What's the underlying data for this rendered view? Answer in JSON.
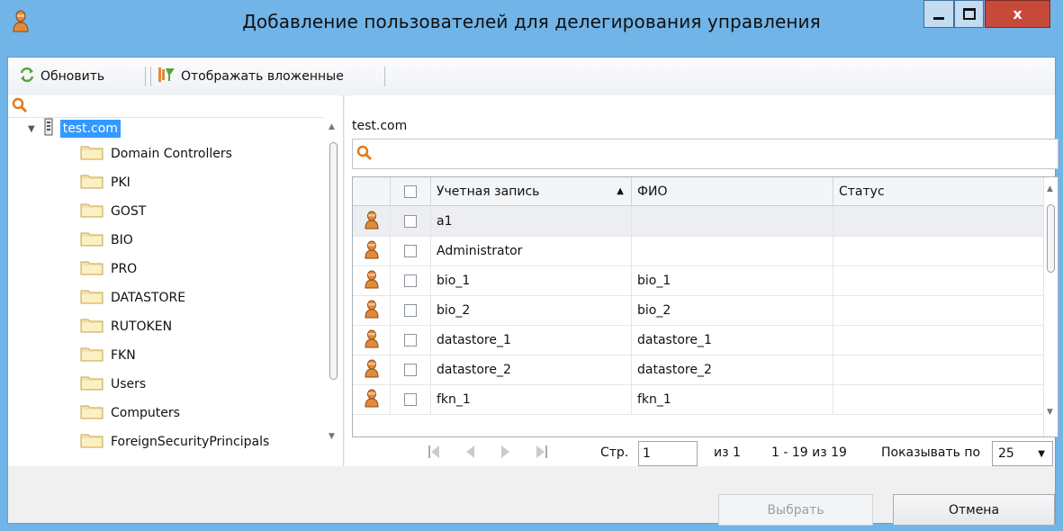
{
  "window": {
    "title": "Добавление пользователей для делегирования управления",
    "close_glyph": "x"
  },
  "toolbar": {
    "refresh_label": "Обновить",
    "show_nested_label": "Отображать вложенные"
  },
  "tree": {
    "root_label": "test.com",
    "items": [
      {
        "label": "Domain Controllers"
      },
      {
        "label": "PKI"
      },
      {
        "label": "GOST"
      },
      {
        "label": "BIO"
      },
      {
        "label": "PRO"
      },
      {
        "label": "DATASTORE"
      },
      {
        "label": "RUTOKEN"
      },
      {
        "label": "FKN"
      },
      {
        "label": "Users"
      },
      {
        "label": "Computers"
      },
      {
        "label": "ForeignSecurityPrincipals"
      }
    ]
  },
  "grid": {
    "path_label": "test.com",
    "headers": {
      "account": "Учетная запись",
      "fio": "ФИО",
      "status": "Статус"
    },
    "sort_column": "account",
    "sort_direction": "ascending",
    "rows": [
      {
        "account": "a1",
        "fio": "",
        "status": ""
      },
      {
        "account": "Administrator",
        "fio": "",
        "status": ""
      },
      {
        "account": "bio_1",
        "fio": "bio_1",
        "status": ""
      },
      {
        "account": "bio_2",
        "fio": "bio_2",
        "status": ""
      },
      {
        "account": "datastore_1",
        "fio": "datastore_1",
        "status": ""
      },
      {
        "account": "datastore_2",
        "fio": "datastore_2",
        "status": ""
      },
      {
        "account": "fkn_1",
        "fio": "fkn_1",
        "status": ""
      }
    ]
  },
  "pager": {
    "page_label": "Стр.",
    "page_value": "1",
    "of_label": "из 1",
    "range_label": "1 - 19 из 19",
    "page_size_label": "Показывать по",
    "page_size_value": "25"
  },
  "footer": {
    "select_label": "Выбрать",
    "cancel_label": "Отмена"
  },
  "colors": {
    "frame": "#70b4e8",
    "close_button": "#c7493a",
    "selection": "#3399ff"
  },
  "icons": {
    "app": "user-icon",
    "refresh": "refresh-icon",
    "nested": "nested-filter-icon",
    "search": "search-icon",
    "domain": "server-icon",
    "folder": "folder-icon",
    "user": "user-icon"
  }
}
